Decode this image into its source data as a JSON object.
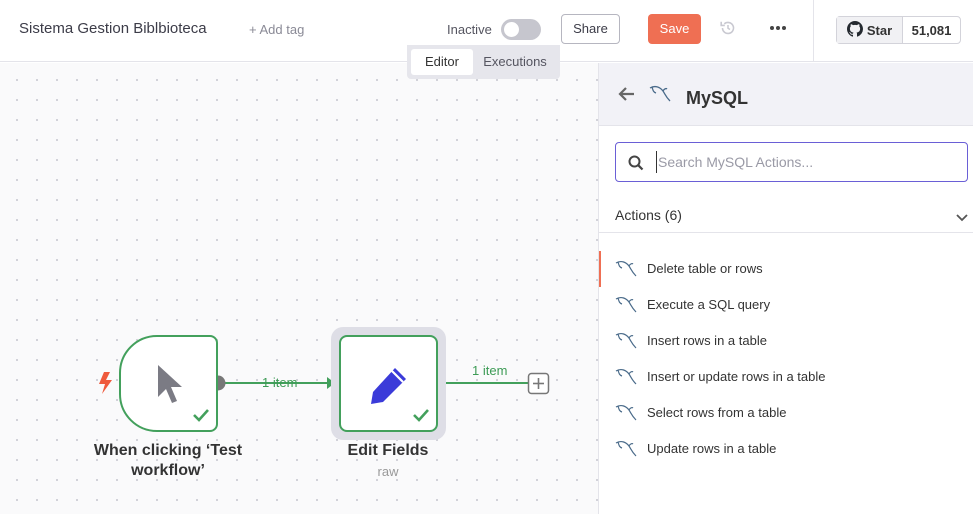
{
  "header": {
    "workflow_name": "Sistema Gestion Biblbioteca",
    "add_tag": "+ Add tag",
    "status_label": "Inactive",
    "share_label": "Share",
    "save_label": "Save",
    "github_star_label": "Star",
    "github_star_count": "51,081"
  },
  "canvas_tabs": [
    {
      "label": "Editor",
      "active": true
    },
    {
      "label": "Executions",
      "active": false
    }
  ],
  "nodes": {
    "trigger": {
      "title_line1": "When clicking ‘Test",
      "title_line2": "workflow’",
      "icon": "cursor-icon",
      "status": "success"
    },
    "edit_fields": {
      "title": "Edit Fields",
      "subtitle": "raw",
      "icon": "pencil-icon",
      "status": "success"
    }
  },
  "connections": {
    "first_label": "1 item",
    "second_label": "1 item"
  },
  "panel": {
    "title": "MySQL",
    "search_placeholder": "Search MySQL Actions...",
    "actions_header": "Actions (6)",
    "actions": [
      {
        "label": "Delete table or rows",
        "active": true
      },
      {
        "label": "Execute a SQL query",
        "active": false
      },
      {
        "label": "Insert rows in a table",
        "active": false
      },
      {
        "label": "Insert or update rows in a table",
        "active": false
      },
      {
        "label": "Select rows from a table",
        "active": false
      },
      {
        "label": "Update rows in a table",
        "active": false
      }
    ]
  },
  "colors": {
    "accent": "#ef6f53",
    "success": "#43a05c",
    "focus": "#6a5fd6",
    "edit_icon": "#3b3bd9"
  }
}
